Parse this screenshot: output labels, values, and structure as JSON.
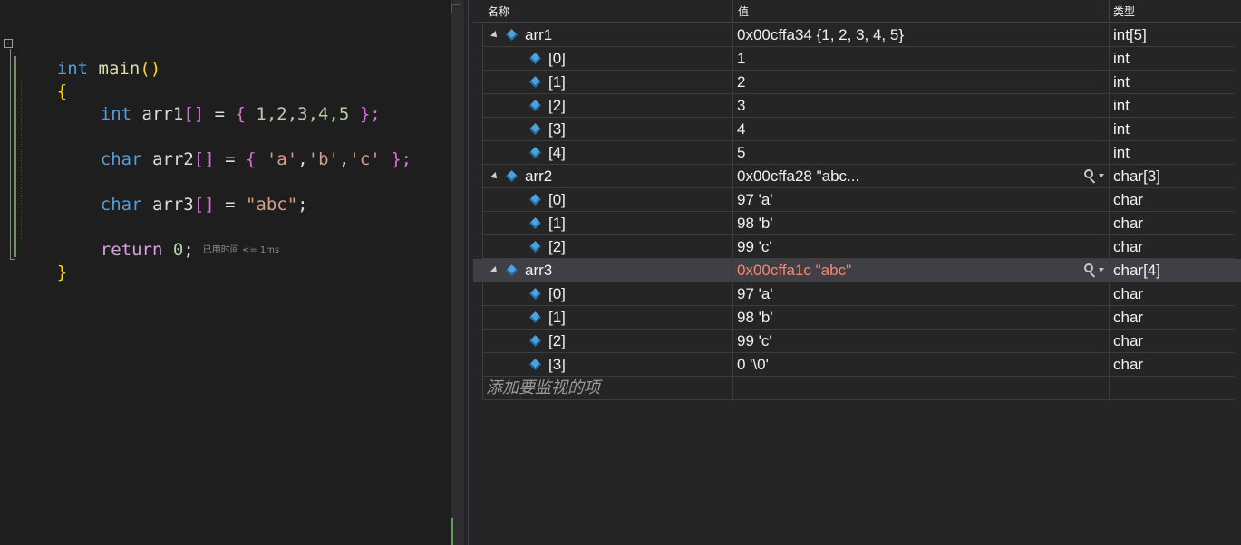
{
  "editor": {
    "fold_symbol": "-",
    "tokens": {
      "kw_int": "int",
      "fn_main": "main",
      "parens": "()",
      "brace_open": "{",
      "brace_close": "}",
      "kw_char": "char",
      "kw_return": "return",
      "var_arr1": "arr1",
      "var_arr2": "arr2",
      "var_arr3": "arr3",
      "brackets": "[]",
      "eq": " = ",
      "init1_open": "{ ",
      "init1_values": "1,2,3,4,5",
      "init1_close": " };",
      "init2_open": "{ ",
      "char_a": "'a'",
      "char_b": "'b'",
      "char_c": "'c'",
      "comma": ",",
      "init2_close": " };",
      "str_abc": "\"abc\"",
      "semi": ";",
      "zero": "0",
      "ret_semi": ";"
    },
    "perf_hint": "已用时间 <= 1ms"
  },
  "watch": {
    "columns": {
      "name": "名称",
      "value": "值",
      "type": "类型"
    },
    "rows": [
      {
        "name": "arr1",
        "value": "0x00cffa34 {1, 2, 3, 4, 5}",
        "type": "int[5]",
        "level": 0,
        "expanded": true
      },
      {
        "name": "[0]",
        "value": "1",
        "type": "int",
        "level": 1
      },
      {
        "name": "[1]",
        "value": "2",
        "type": "int",
        "level": 1
      },
      {
        "name": "[2]",
        "value": "3",
        "type": "int",
        "level": 1
      },
      {
        "name": "[3]",
        "value": "4",
        "type": "int",
        "level": 1
      },
      {
        "name": "[4]",
        "value": "5",
        "type": "int",
        "level": 1
      },
      {
        "name": "arr2",
        "value": "0x00cffa28 \"abc...",
        "type": "char[3]",
        "level": 0,
        "expanded": true,
        "visualizer": true
      },
      {
        "name": "[0]",
        "value": "97 'a'",
        "type": "char",
        "level": 1
      },
      {
        "name": "[1]",
        "value": "98 'b'",
        "type": "char",
        "level": 1
      },
      {
        "name": "[2]",
        "value": "99 'c'",
        "type": "char",
        "level": 1
      },
      {
        "name": "arr3",
        "value": "0x00cffa1c \"abc\"",
        "type": "char[4]",
        "level": 0,
        "expanded": true,
        "visualizer": true,
        "selected": true,
        "changed": true
      },
      {
        "name": "[0]",
        "value": "97 'a'",
        "type": "char",
        "level": 1
      },
      {
        "name": "[1]",
        "value": "98 'b'",
        "type": "char",
        "level": 1
      },
      {
        "name": "[2]",
        "value": "99 'c'",
        "type": "char",
        "level": 1
      },
      {
        "name": "[3]",
        "value": "0 '\\0'",
        "type": "char",
        "level": 1
      }
    ],
    "add_placeholder": "添加要监视的项",
    "colors": {
      "changed_value": "#f48771",
      "variable_icon": "#4aa3df",
      "selected_row": "#3f3f46"
    }
  }
}
